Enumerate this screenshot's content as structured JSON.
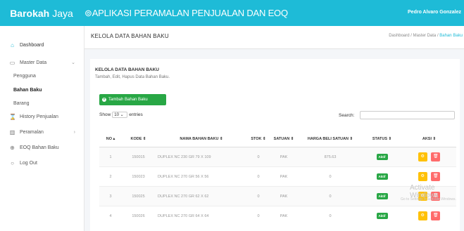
{
  "topbar": {
    "brand_bold": "Barokah",
    "brand_light": "Jaya",
    "app_title": "APLIKASI PERAMALAN PENJUALAN DAN EOQ",
    "user": "Pedro Alvaro Gonzalez"
  },
  "sidebar": {
    "items": [
      {
        "label": "Dashboard"
      },
      {
        "label": "Master Data"
      },
      {
        "label": "Pengguna"
      },
      {
        "label": "Bahan Baku"
      },
      {
        "label": "Barang"
      },
      {
        "label": "History Penjualan"
      },
      {
        "label": "Peramalan"
      },
      {
        "label": "EOQ Bahan Baku"
      },
      {
        "label": "Log Out"
      }
    ]
  },
  "header": {
    "title": "KELOLA DATA BAHAN BAKU",
    "breadcrumb": [
      "Dashboard",
      "Master Data",
      "Bahan Baku"
    ]
  },
  "card": {
    "title": "KELOLA DATA BAHAN BAKU",
    "subtitle": "Tambah, Edit, Hapus Data Bahan Baku.",
    "add_button": "Tambah Bahan Baku",
    "show_label": "Show",
    "show_value": "10",
    "entries_label": "entries",
    "search_label": "Search:"
  },
  "table": {
    "headers": [
      "NO",
      "KODE",
      "NAMA BAHAN BAKU",
      "STOK",
      "SATUAN",
      "HARGA BELI SATUAN",
      "STATUS",
      "AKSI"
    ],
    "rows": [
      {
        "no": "1",
        "kode": "150015",
        "nama": "DUPLEX NC 230 GR 79 X 109",
        "stok": "0",
        "satuan": "PAK",
        "harga": "875.63",
        "status": "Aktif"
      },
      {
        "no": "2",
        "kode": "150023",
        "nama": "DUPLEX NC 270 GR 56 X 56",
        "stok": "0",
        "satuan": "PAK",
        "harga": "0",
        "status": "Aktif"
      },
      {
        "no": "3",
        "kode": "150025",
        "nama": "DUPLEX NC 270 GR 62 X 62",
        "stok": "0",
        "satuan": "PAK",
        "harga": "0",
        "status": "Aktif"
      },
      {
        "no": "4",
        "kode": "150026",
        "nama": "DUPLEX NC 270 GR 64 X 64",
        "stok": "0",
        "satuan": "PAK",
        "harga": "0",
        "status": "Aktif"
      }
    ]
  },
  "watermark": {
    "line1": "Activate Windows",
    "line2": "Go to Settings to activate Windows."
  },
  "colors": {
    "topbar": "#1ebbd7",
    "success": "#28a745",
    "warning": "#ffc107",
    "danger": "#ff6b6b"
  }
}
